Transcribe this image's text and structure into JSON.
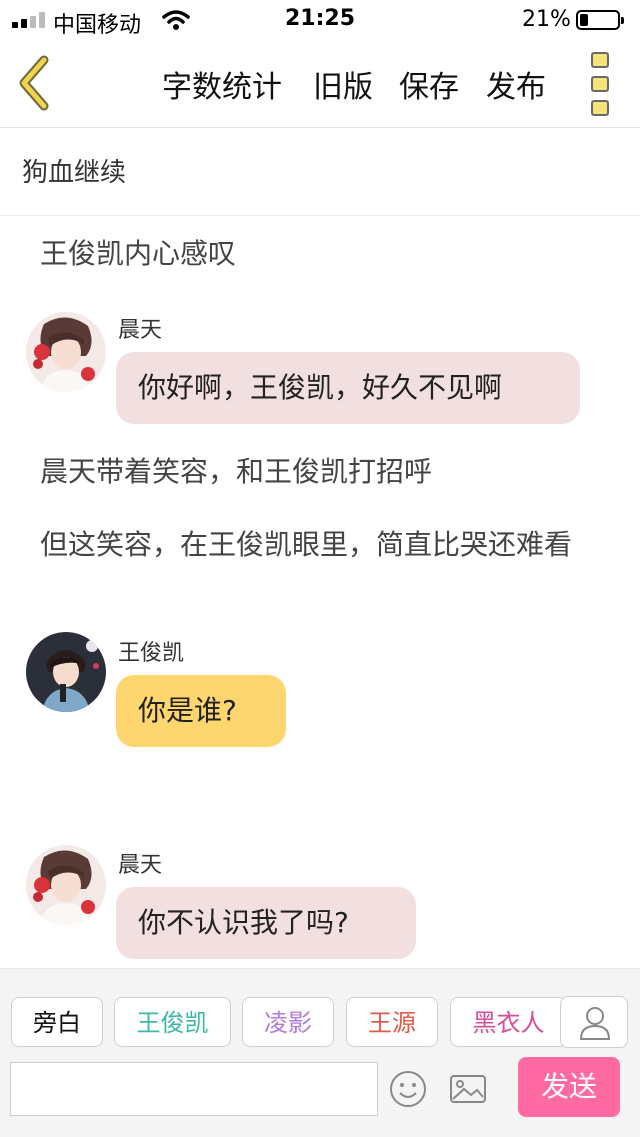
{
  "status_bar": {
    "carrier": "中国移动",
    "time": "21:25",
    "battery": "21%"
  },
  "nav": {
    "actions": [
      "字数统计",
      "旧版",
      "保存",
      "发布"
    ]
  },
  "chapter_title": "狗血继续",
  "content": [
    {
      "type": "narration",
      "text": "王俊凯内心感叹"
    },
    {
      "type": "dialog",
      "speaker": "晨天",
      "text": "你好啊，王俊凯，好久不见啊",
      "bubble_color": "#f2dfe0"
    },
    {
      "type": "narration",
      "text": "晨天带着笑容，和王俊凯打招呼"
    },
    {
      "type": "narration",
      "text": "但这笑容，在王俊凯眼里，简直比哭还难看"
    },
    {
      "type": "dialog",
      "speaker": "王俊凯",
      "text": "你是谁?",
      "bubble_color": "#fdd66f"
    },
    {
      "type": "dialog",
      "speaker": "晨天",
      "text": "你不认识我了吗?",
      "bubble_color": "#f2dfe0"
    }
  ],
  "roles": [
    {
      "label": "旁白",
      "color": "#111111"
    },
    {
      "label": "王俊凯",
      "color": "#3bb8a8"
    },
    {
      "label": "凌影",
      "color": "#b07ad6"
    },
    {
      "label": "王源",
      "color": "#e05a4a"
    },
    {
      "label": "黑衣人",
      "color": "#d44e9a"
    }
  ],
  "input": {
    "value": ""
  },
  "send_label": "发送",
  "icons": {
    "back": "back-chevron-icon",
    "more": "more-menu-icon",
    "add_role": "person-icon",
    "emoji": "emoji-icon",
    "image": "image-icon",
    "wifi": "wifi-icon"
  },
  "colors": {
    "accent": "#f3d24e",
    "send": "#ff6aa2"
  }
}
